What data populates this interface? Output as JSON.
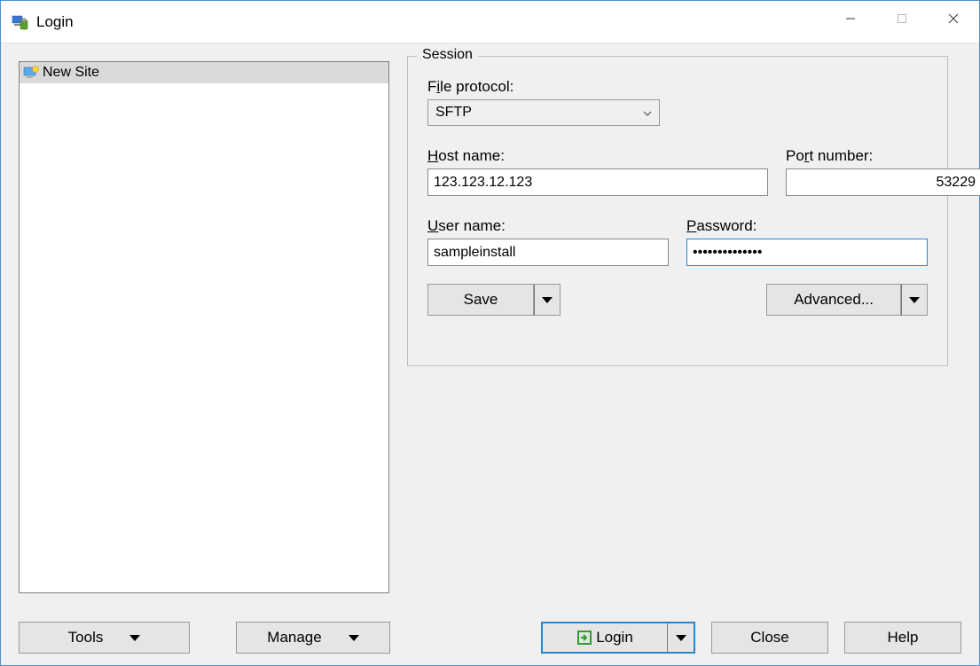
{
  "window": {
    "title": "Login"
  },
  "site_list": {
    "items": [
      {
        "label": "New Site",
        "selected": true
      }
    ]
  },
  "session": {
    "group_label": "Session",
    "protocol_label_pre": "F",
    "protocol_label_u": "i",
    "protocol_label_post": "le protocol:",
    "protocol_value": "SFTP",
    "host_label_u": "H",
    "host_label_post": "ost name:",
    "host_value": "123.123.12.123",
    "port_label_pre": "Po",
    "port_label_u": "r",
    "port_label_post": "t number:",
    "port_value": "53229",
    "user_label_u": "U",
    "user_label_post": "ser name:",
    "user_value": "sampleinstall",
    "pass_label_u": "P",
    "pass_label_post": "assword:",
    "pass_value": "••••••••••••••",
    "save_label": "Save",
    "advanced_label": "Advanced..."
  },
  "bottom": {
    "tools_label": "Tools",
    "manage_label": "Manage",
    "login_label": "Login",
    "close_label": "Close",
    "help_label": "Help"
  }
}
